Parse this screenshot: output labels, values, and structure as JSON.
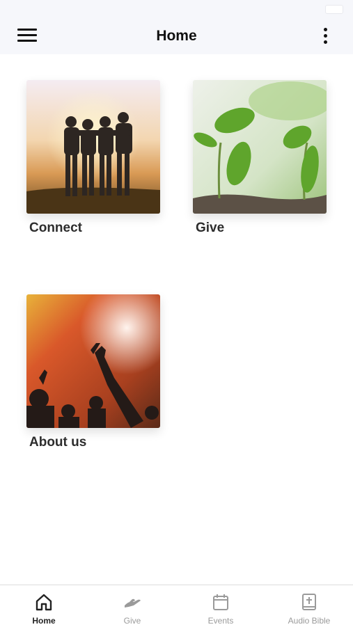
{
  "header": {
    "title": "Home"
  },
  "tiles": [
    {
      "label": "Connect"
    },
    {
      "label": "Give"
    },
    {
      "label": "About us"
    }
  ],
  "tab_bar": {
    "items": [
      {
        "label": "Home",
        "icon": "home-icon",
        "active": true
      },
      {
        "label": "Give",
        "icon": "giving-hand-icon",
        "active": false
      },
      {
        "label": "Events",
        "icon": "calendar-icon",
        "active": false
      },
      {
        "label": "Audio Bible",
        "icon": "bible-icon",
        "active": false
      }
    ]
  },
  "colors": {
    "header_bg": "#f6f7fb",
    "active_tab": "#222222",
    "inactive_tab": "#9a9a9a"
  }
}
